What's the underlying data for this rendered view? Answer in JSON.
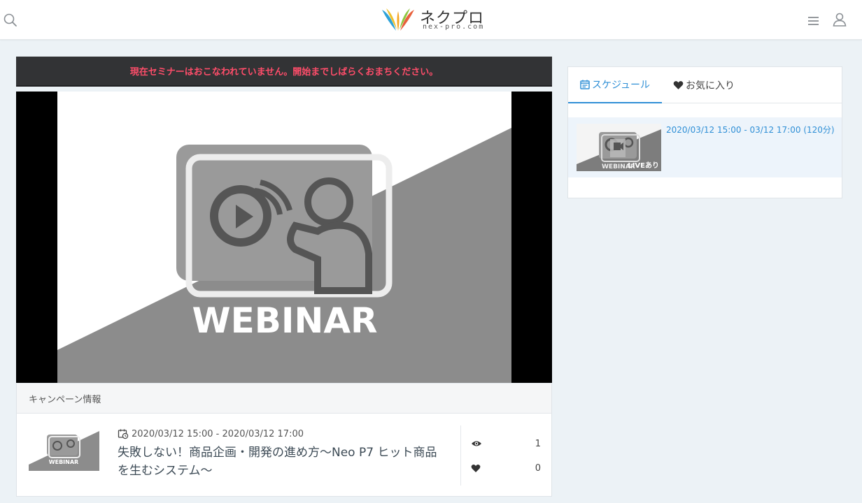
{
  "header": {
    "logo_text": "ネクプロ",
    "logo_subtext": "nex-pro.com",
    "icons": {
      "search": "search-icon",
      "menu": "hamburger-menu-icon",
      "user": "user-icon"
    }
  },
  "notice": {
    "text": "現在セミナーはおこなわれていません。開始までしばらくおまちください。",
    "color": "#ff4d6a"
  },
  "player": {
    "thumbnail_text": "WEBINAR"
  },
  "campaign": {
    "header_label": "キャンペーン情報",
    "item": {
      "thumbnail_text": "WEBINAR",
      "datetime": "2020/03/12 15:00 - 2020/03/12 17:00",
      "title": "失敗しない！商品企画・開発の進め方〜Neo P7 ヒット商品を生むシステム〜",
      "views": "1",
      "likes": "0"
    }
  },
  "sidebar": {
    "tabs": [
      {
        "label": "スケジュール",
        "icon": "calendar-icon",
        "active": true
      },
      {
        "label": "お気に入り",
        "icon": "heart-icon",
        "active": false
      }
    ],
    "schedule_items": [
      {
        "datetime": "2020/03/12 15:00 - 03/12 17:00 (120分)",
        "badge": "LIVEあり",
        "thumbnail_text": "WEBINAR"
      }
    ]
  },
  "colors": {
    "accent": "#2f8fd6",
    "background": "#ecf2f6",
    "notice_bg": "#323335"
  }
}
